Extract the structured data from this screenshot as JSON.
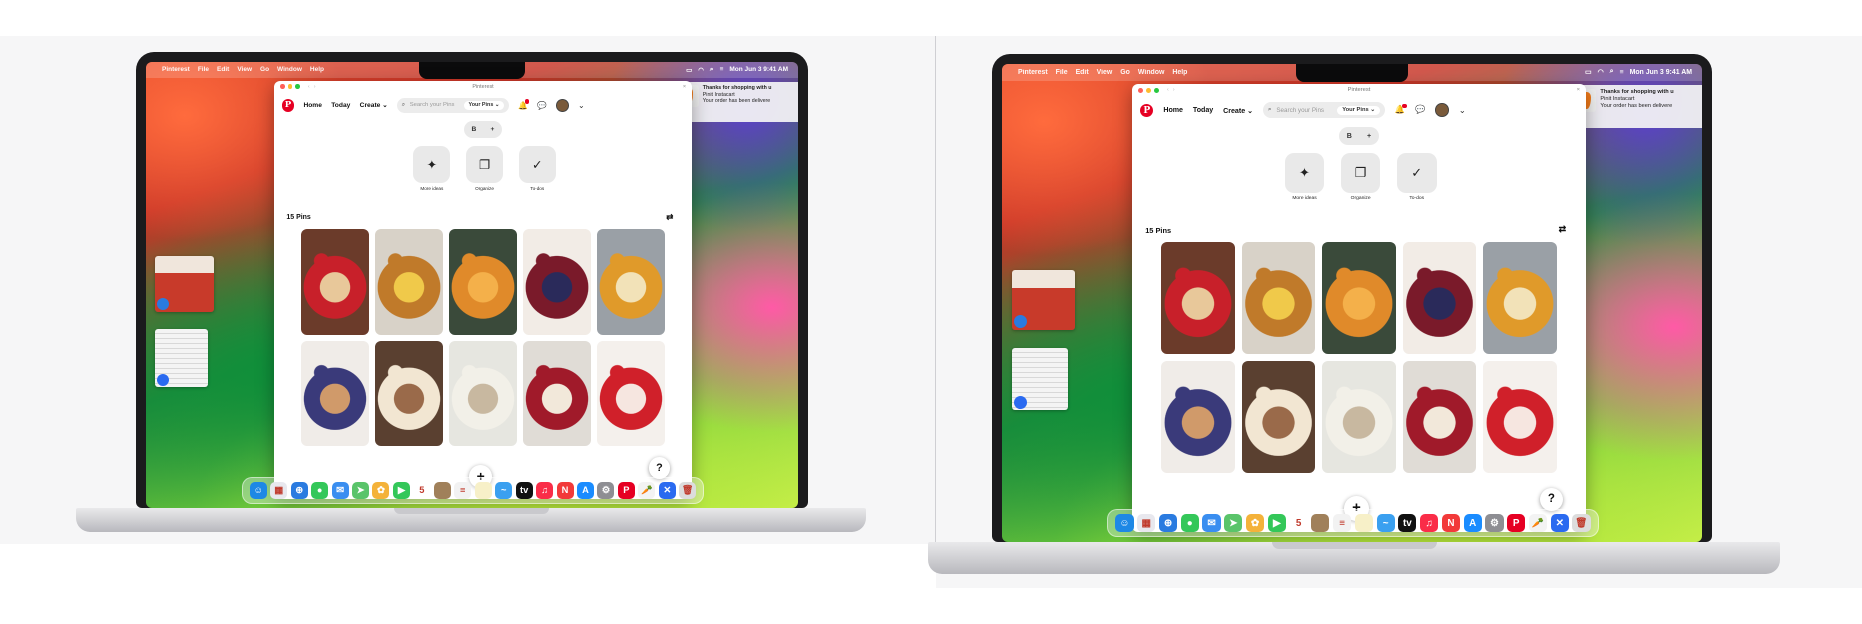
{
  "menubar": {
    "app": "Pinterest",
    "items": [
      "File",
      "Edit",
      "View",
      "Go",
      "Window",
      "Help"
    ],
    "clock": "Mon Jun 3 9:41 AM"
  },
  "window": {
    "title": "Pinterest",
    "nav": {
      "logo": "P",
      "home": "Home",
      "today": "Today",
      "create": "Create",
      "search_placeholder": "Search your Pins",
      "scope": "Your Pins"
    },
    "board_pill": {
      "letter": "B",
      "add": "+"
    },
    "tools": [
      {
        "label": "More ideas",
        "icon": "sparkle-icon",
        "glyph": "✦"
      },
      {
        "label": "Organize",
        "icon": "organize-icon",
        "glyph": "❐"
      },
      {
        "label": "To-dos",
        "icon": "check-circle-icon",
        "glyph": "✓"
      }
    ],
    "pins_count": "15 Pins",
    "filter_glyph": "⇄",
    "fab_add": "+",
    "fab_help": "?"
  },
  "notification": {
    "title": "Thanks for shopping with u",
    "line2": "Pinit Instacart",
    "line3": "Your order has been delivere"
  },
  "pins": [
    {
      "name": "strawberry-tart",
      "colors": [
        "#6b3b2a",
        "#c8202a",
        "#e8c89a"
      ]
    },
    {
      "name": "bundt-cake",
      "colors": [
        "#d8d2c8",
        "#c07a2a",
        "#f0c94a"
      ]
    },
    {
      "name": "citrus-cake",
      "colors": [
        "#3a4a3a",
        "#e08a2a",
        "#f4b04a"
      ]
    },
    {
      "name": "berry-pavlova",
      "colors": [
        "#f2ece6",
        "#7a1a2a",
        "#2a2a5a"
      ]
    },
    {
      "name": "orange-tart",
      "colors": [
        "#9aa0a6",
        "#e09a2a",
        "#f2e2b8"
      ]
    },
    {
      "name": "blueberry-bars",
      "colors": [
        "#f0ece8",
        "#3a3a7a",
        "#d09a6a"
      ]
    },
    {
      "name": "iced-cake",
      "colors": [
        "#5a4030",
        "#f2e6d2",
        "#9a6a4a"
      ]
    },
    {
      "name": "cream-puffs",
      "colors": [
        "#e6e6e0",
        "#f2f0e8",
        "#c8b8a0"
      ]
    },
    {
      "name": "berry-cheesecake",
      "colors": [
        "#e0dcd6",
        "#a01a2a",
        "#f2e8da"
      ]
    },
    {
      "name": "strawberry-cupcakes",
      "colors": [
        "#f4f0ec",
        "#d0202a",
        "#f6e6e0"
      ]
    }
  ],
  "dock": [
    {
      "name": "finder",
      "color": "#1e88e5",
      "glyph": "☺"
    },
    {
      "name": "launchpad",
      "color": "#e8e8ee",
      "glyph": "▦"
    },
    {
      "name": "safari",
      "color": "#2a7be0",
      "glyph": "⊕"
    },
    {
      "name": "messages",
      "color": "#34c759",
      "glyph": "●"
    },
    {
      "name": "mail",
      "color": "#3a8ef0",
      "glyph": "✉"
    },
    {
      "name": "maps",
      "color": "#5ac46a",
      "glyph": "➤"
    },
    {
      "name": "photos",
      "color": "#f4b23a",
      "glyph": "✿"
    },
    {
      "name": "facetime",
      "color": "#34c759",
      "glyph": "▶"
    },
    {
      "name": "calendar",
      "color": "#ffffff",
      "glyph": "5"
    },
    {
      "name": "notes-brown",
      "color": "#a0805a",
      "glyph": ""
    },
    {
      "name": "reminders",
      "color": "#f2f2f2",
      "glyph": "≡"
    },
    {
      "name": "notes",
      "color": "#f7f0c8",
      "glyph": ""
    },
    {
      "name": "freeform",
      "color": "#3aa0f0",
      "glyph": "~"
    },
    {
      "name": "apple-tv",
      "color": "#111111",
      "glyph": "tv"
    },
    {
      "name": "music",
      "color": "#fa2d48",
      "glyph": "♫"
    },
    {
      "name": "news",
      "color": "#f23a3a",
      "glyph": "N"
    },
    {
      "name": "app-store",
      "color": "#1a8cff",
      "glyph": "A"
    },
    {
      "name": "system-settings",
      "color": "#8e8e93",
      "glyph": "⚙"
    },
    {
      "name": "pinterest",
      "color": "#e60023",
      "glyph": "P"
    },
    {
      "name": "instacart",
      "color": "#f3f3f3",
      "glyph": "🥕"
    },
    {
      "name": "xcode",
      "color": "#2a6af0",
      "glyph": "✕"
    },
    {
      "name": "trash",
      "color": "#dcdcdc",
      "glyph": "🗑"
    }
  ]
}
